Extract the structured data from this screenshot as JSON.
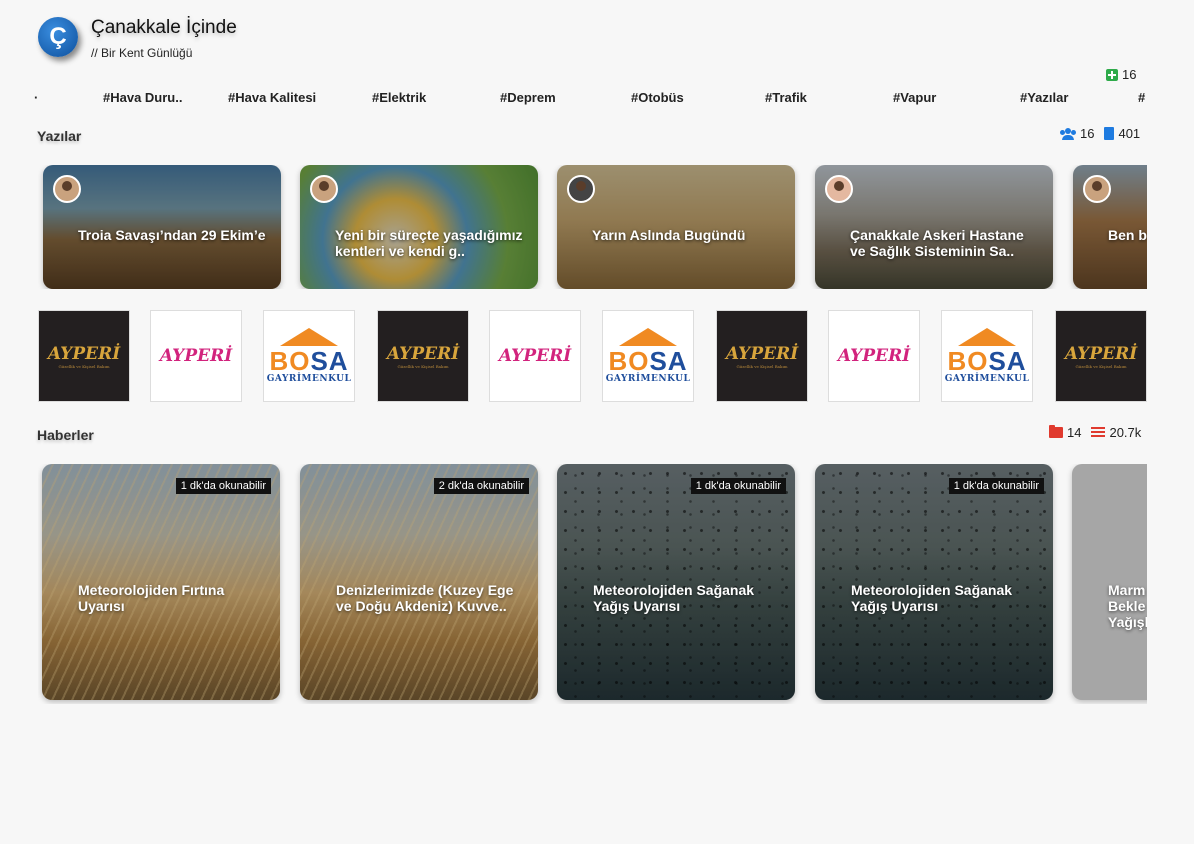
{
  "site": {
    "logo_letter": "Ç",
    "title": "Çanakkale İçinde",
    "subtitle": "// Bir Kent Günlüğü"
  },
  "header_stat": {
    "icon": "medkit-icon",
    "value": "16",
    "color": "#2eaa4a"
  },
  "tags": [
    "#Hava Duru..",
    "#Hava Kalitesi",
    "#Elektrik",
    "#Deprem",
    "#Otobüs",
    "#Trafik",
    "#Vapur",
    "#Yazılar"
  ],
  "yazilar": {
    "title": "Yazılar",
    "authors_count": "16",
    "posts_count": "401",
    "icon_color": "#1e7be0",
    "cards": [
      {
        "title": "Troia Savaşı’ndan 29 Ekim’e"
      },
      {
        "title": "Yeni bir süreçte yaşadığımız kentleri ve kendi g.."
      },
      {
        "title": "Yarın Aslında Bugündü"
      },
      {
        "title": "Çanakkale Askeri Hastane ve Sağlık Sisteminin Sa.."
      },
      {
        "title": "Ben b"
      }
    ]
  },
  "ads": [
    {
      "brand": "AYPERİ",
      "tagline": "Güzellik ve Kişisel Bakım",
      "style": "dark"
    },
    {
      "brand": "AYPERİ",
      "style": "light"
    },
    {
      "brand_a": "BO",
      "brand_b": "SA",
      "sub": "GAYRİMENKUL",
      "style": "bosa"
    },
    {
      "brand": "AYPERİ",
      "tagline": "Güzellik ve Kişisel Bakım",
      "style": "dark"
    },
    {
      "brand": "AYPERİ",
      "style": "light"
    },
    {
      "brand_a": "BO",
      "brand_b": "SA",
      "sub": "GAYRİMENKUL",
      "style": "bosa"
    },
    {
      "brand": "AYPERİ",
      "tagline": "Güzellik ve Kişisel Bakım",
      "style": "dark"
    },
    {
      "brand": "AYPERİ",
      "style": "light"
    },
    {
      "brand_a": "BO",
      "brand_b": "SA",
      "sub": "GAYRİMENKUL",
      "style": "bosa"
    },
    {
      "brand": "AYPERİ",
      "tagline": "Güzellik ve Kişisel Bakım",
      "style": "dark"
    }
  ],
  "haberler": {
    "title": "Haberler",
    "folder_count": "14",
    "list_count": "20.7k",
    "icon_color": "#e03a2e",
    "cards": [
      {
        "badge": "1 dk'da okunabilir",
        "title": "Meteorolojiden Fırtına Uyarısı",
        "image": "grass"
      },
      {
        "badge": "2 dk'da okunabilir",
        "title": "Denizlerimizde (Kuzey Ege ve Doğu Akdeniz) Kuvve..",
        "image": "grass"
      },
      {
        "badge": "1 dk'da okunabilir",
        "title": "Meteorolojiden Sağanak Yağış Uyarısı",
        "image": "rain"
      },
      {
        "badge": "1 dk'da okunabilir",
        "title": "Meteorolojiden Sağanak Yağış Uyarısı",
        "image": "rain"
      },
      {
        "badge": "",
        "title": "Marm Bekle Yağışl",
        "image": "plain"
      }
    ]
  }
}
